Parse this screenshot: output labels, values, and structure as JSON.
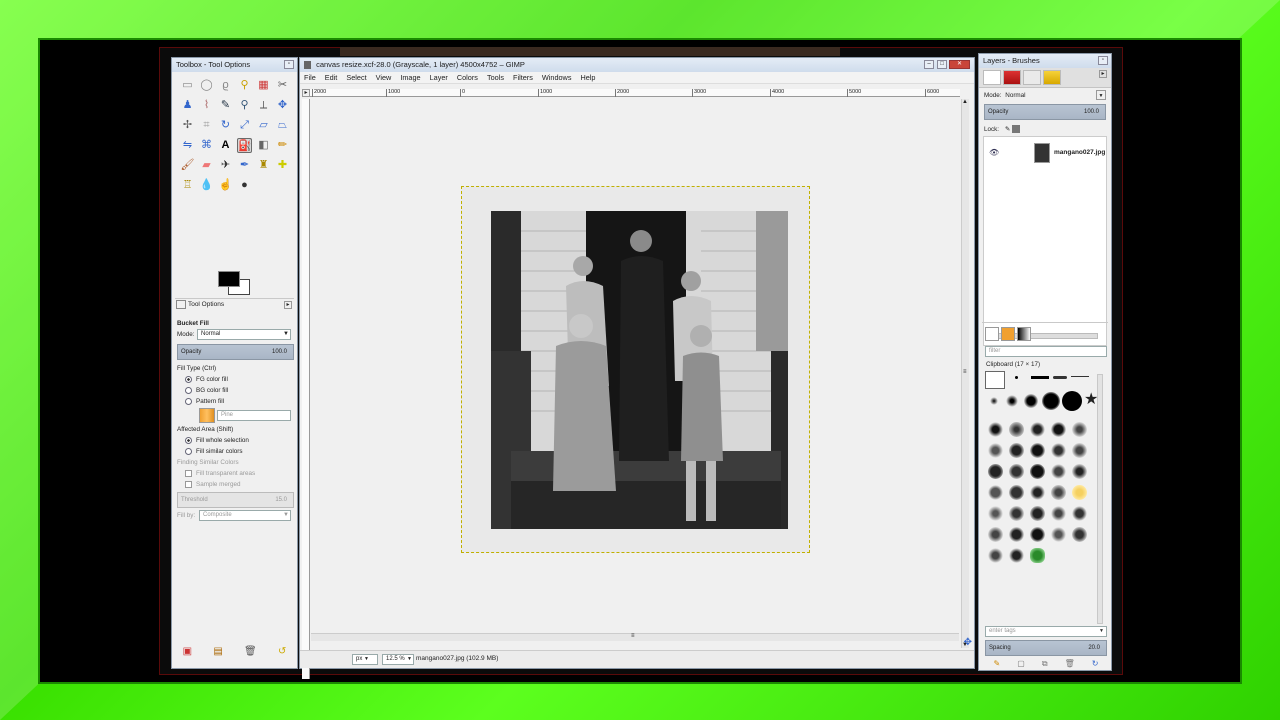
{
  "toolbox": {
    "title": "Toolbox - Tool Options",
    "tool_options_tab": "Tool Options",
    "tool_name": "Bucket Fill",
    "mode_label": "Mode:",
    "mode_value": "Normal",
    "opacity_label": "Opacity",
    "opacity_value": "100.0",
    "fill_type_label": "Fill Type  (Ctrl)",
    "fill_options": [
      "FG color fill",
      "BG color fill",
      "Pattern fill"
    ],
    "pattern_name": "Pine",
    "affected_area_label": "Affected Area  (Shift)",
    "affected_options": [
      "Fill whole selection",
      "Fill similar colors"
    ],
    "finding_label": "Finding Similar Colors",
    "fill_transparent": "Fill transparent areas",
    "sample_merged": "Sample merged",
    "threshold_label": "Threshold",
    "threshold_value": "15.0",
    "fill_by_label": "Fill by:",
    "fill_by_value": "Composite"
  },
  "main": {
    "title": "canvas resize.xcf-28.0 (Grayscale, 1 layer) 4500x4752 – GIMP",
    "menu": [
      "File",
      "Edit",
      "Select",
      "View",
      "Image",
      "Layer",
      "Colors",
      "Tools",
      "Filters",
      "Windows",
      "Help"
    ],
    "ruler_labels": [
      "2000",
      "1000",
      "0",
      "1000",
      "2000",
      "3000",
      "4000",
      "5000",
      "6000"
    ],
    "unit": "px",
    "zoom": "12.5 %",
    "status": "mangano027.jpg (102.9 MB)"
  },
  "layers": {
    "title": "Layers - Brushes",
    "mode_label": "Mode:",
    "mode_value": "Normal",
    "opacity_label": "Opacity",
    "opacity_value": "100.0",
    "lock_label": "Lock:",
    "layer_name": "mangano027.jpg",
    "filter_placeholder": "filter",
    "clipboard_label": "Clipboard (17 × 17)",
    "tags_placeholder": "enter tags",
    "spacing_label": "Spacing",
    "spacing_value": "20.0"
  },
  "colors": {
    "frame": "#39e000",
    "fg": "#000000",
    "bg": "#ffffff",
    "selection_border": "#c0b000"
  }
}
